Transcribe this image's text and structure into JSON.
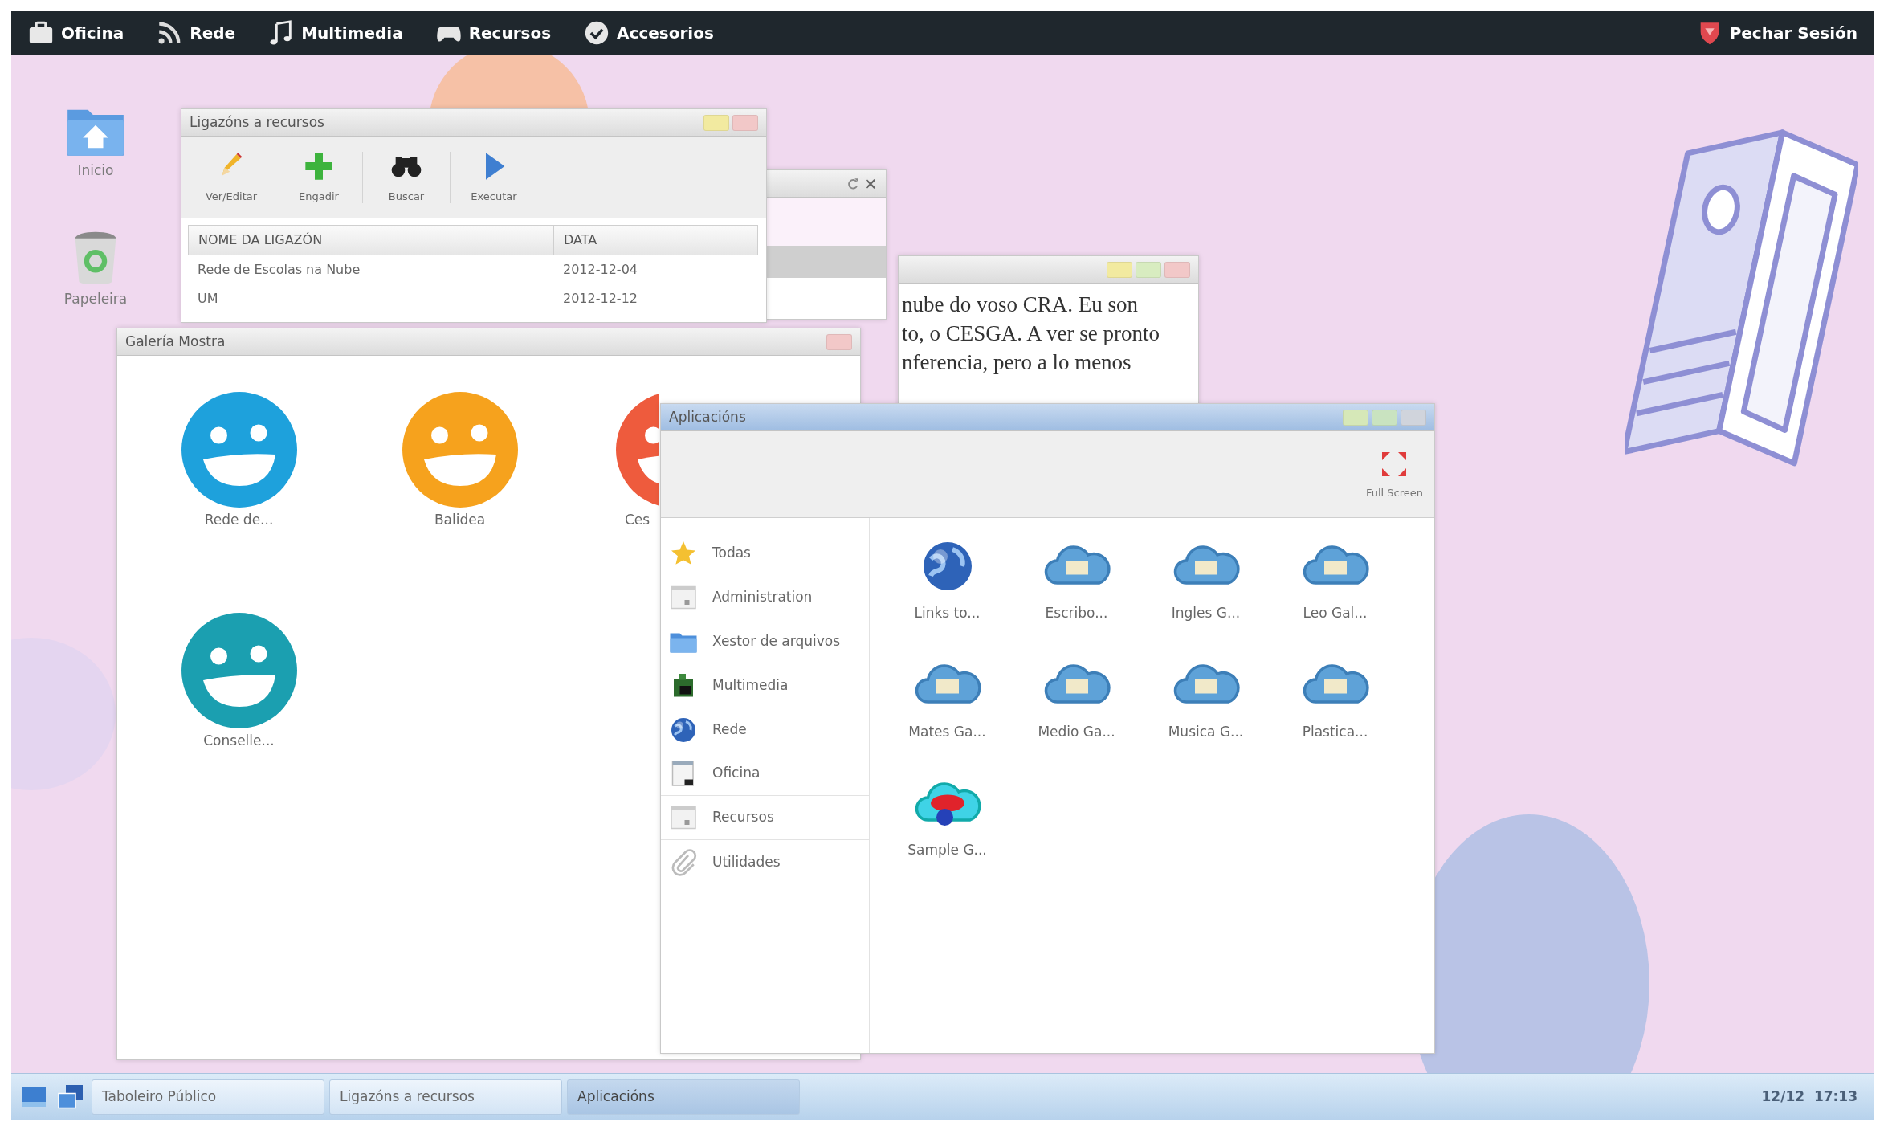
{
  "menu_bar": {
    "items": [
      {
        "label": "Oficina",
        "kind": "briefcase"
      },
      {
        "label": "Rede",
        "kind": "rss"
      },
      {
        "label": "Multimedia",
        "kind": "music"
      },
      {
        "label": "Recursos",
        "kind": "gamepad"
      },
      {
        "label": "Accesorios",
        "kind": "check"
      }
    ],
    "logout": {
      "label": "Pechar Sesión",
      "kind": "shield"
    }
  },
  "desktop_icons": [
    {
      "label": "Inicio",
      "kind": "home"
    },
    {
      "label": "Papeleira",
      "kind": "trash"
    }
  ],
  "links_window": {
    "title": "Ligazóns a recursos",
    "controls": [
      {
        "color": "#f2eaa0"
      },
      {
        "color": "#f2c8c8"
      }
    ],
    "toolbar": [
      {
        "label": "Ver/Editar",
        "kind": "pencil"
      },
      {
        "label": "Engadir",
        "kind": "plus"
      },
      {
        "label": "Buscar",
        "kind": "binoculars"
      },
      {
        "label": "Executar",
        "kind": "play"
      }
    ],
    "columns": [
      "NOME DA LIGAZÓN",
      "DATA"
    ],
    "rows": [
      [
        "Rede de Escolas na Nube",
        "2012-12-04"
      ],
      [
        "UM",
        "2012-12-12"
      ]
    ]
  },
  "small_window": {
    "controls": [
      {
        "kind": "refresh"
      },
      {
        "kind": "close"
      }
    ]
  },
  "chat_window": {
    "controls": [
      {
        "color": "#f2eaa0"
      },
      {
        "color": "#d8ecc0"
      },
      {
        "color": "#f2c8c8"
      }
    ],
    "lines": [
      "nube do voso CRA. Eu son",
      "to, o CESGA. A ver se pronto",
      "nferencia, pero a lo menos"
    ]
  },
  "gallery_window": {
    "title": "Galería Mostra",
    "controls": [
      {
        "color": "#f2c8c8"
      }
    ],
    "items": [
      {
        "label": "Rede de...",
        "color": "#1ea1dc",
        "kind": "full"
      },
      {
        "label": "Balidea",
        "color": "#f6a21d",
        "kind": "full"
      },
      {
        "label": "Ces",
        "color": "#ee5b3d",
        "kind": "partial"
      },
      {
        "label": "Conselle...",
        "color": "#1b9fb0",
        "kind": "full"
      }
    ]
  },
  "apps_window": {
    "title": "Aplicacións",
    "controls": [
      {
        "color": "#d6e8b8"
      },
      {
        "color": "#c9e3c0"
      },
      {
        "color": "#d0d4dc"
      }
    ],
    "full_screen": "Full Screen",
    "categories": [
      {
        "label": "Todas",
        "kind": "star"
      },
      {
        "label": "Administration",
        "kind": "panel"
      },
      {
        "label": "Xestor de arquivos",
        "kind": "folder"
      },
      {
        "label": "Multimedia",
        "kind": "box"
      },
      {
        "label": "Rede",
        "kind": "globe"
      },
      {
        "label": "Oficina",
        "kind": "document"
      },
      {
        "label": "Recursos",
        "kind": "panel"
      },
      {
        "label": "Utilidades",
        "kind": "paperclip"
      }
    ],
    "apps": [
      {
        "label": "Links to...",
        "kind": "globe"
      },
      {
        "label": "Escribo...",
        "kind": "cloud"
      },
      {
        "label": "Ingles G...",
        "kind": "cloud"
      },
      {
        "label": "Leo Gal...",
        "kind": "cloud"
      },
      {
        "label": "Mates Ga...",
        "kind": "cloud"
      },
      {
        "label": "Medio Ga...",
        "kind": "cloud"
      },
      {
        "label": "Musica G...",
        "kind": "cloud"
      },
      {
        "label": "Plastica...",
        "kind": "cloud"
      },
      {
        "label": "Sample G...",
        "kind": "sample"
      }
    ]
  },
  "taskbar": {
    "buttons": [
      {
        "label": "Taboleiro Público",
        "selected": false
      },
      {
        "label": "Ligazóns a recursos",
        "selected": false
      },
      {
        "label": "Aplicacións",
        "selected": true
      }
    ],
    "clock": "12/12  17:13"
  }
}
